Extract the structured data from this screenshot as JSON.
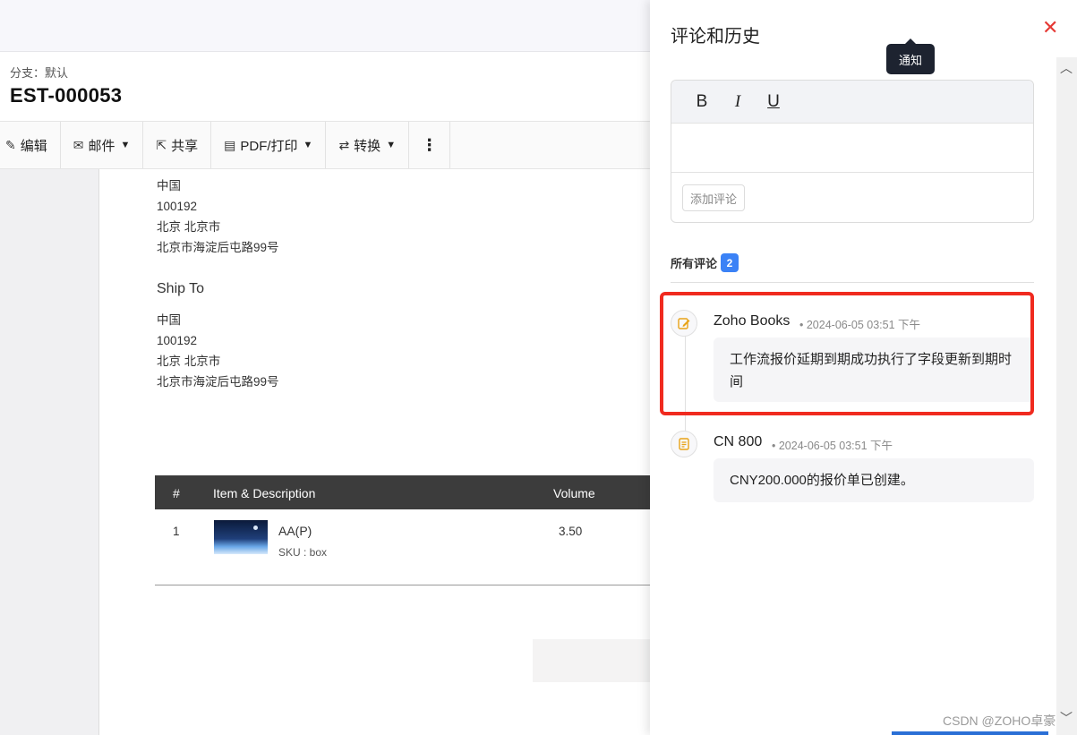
{
  "header": {
    "branch": "分支：默认",
    "doc_id": "EST-000053"
  },
  "toolbar": {
    "edit": "编辑",
    "mail": "邮件",
    "share": "共享",
    "pdf": "PDF/打印",
    "convert": "转换"
  },
  "document": {
    "bill_address": [
      "中国",
      "100192",
      "北京 北京市",
      "北京市海淀后屯路99号"
    ],
    "ship_to_title": "Ship To",
    "ship_address": [
      "中国",
      "100192",
      "北京 北京市",
      "北京市海淀后屯路99号"
    ],
    "table": {
      "headers": [
        "#",
        "Item & Description",
        "Volume"
      ],
      "rows": [
        {
          "num": "1",
          "name": "AA(P)",
          "sku": "SKU : box",
          "volume": "3.50"
        }
      ]
    }
  },
  "panel": {
    "title": "评论和历史",
    "tooltip": "通知",
    "editor": {
      "bold": "B",
      "italic": "I",
      "underline": "U",
      "add_comment": "添加评论"
    },
    "all_comments_label": "所有评论",
    "comment_count": "2",
    "comments": [
      {
        "author": "Zoho Books",
        "time": "2024-06-05 03:51 下午",
        "body": "工作流报价延期到期成功执行了字段更新到期时间",
        "icon": "edit-note-icon"
      },
      {
        "author": "CN 800",
        "time": "2024-06-05 03:51 下午",
        "body": "CNY200.000的报价单已创建。",
        "icon": "document-icon"
      }
    ]
  },
  "watermark": "CSDN @ZOHO卓豪",
  "colors": {
    "accent": "#3b82f6",
    "close": "#e53935",
    "highlight": "#f02a1f",
    "icon": "#e8a317"
  }
}
